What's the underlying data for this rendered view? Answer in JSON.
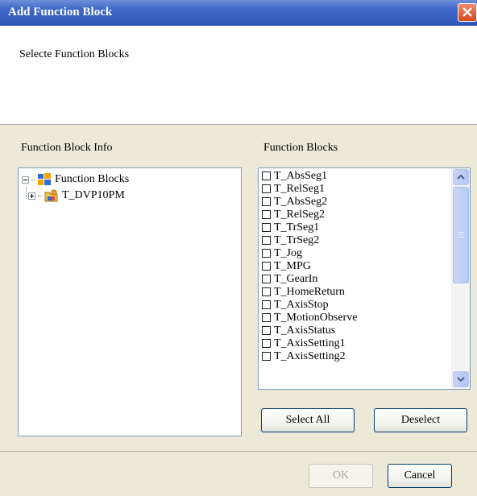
{
  "window": {
    "title": "Add Function Block"
  },
  "header": {
    "text": "Selecte Function Blocks"
  },
  "info_panel": {
    "label": "Function Block Info",
    "tree": [
      {
        "label": "Function Blocks"
      },
      {
        "label": "T_DVP10PM"
      }
    ]
  },
  "blocks_panel": {
    "label": "Function Blocks",
    "items": [
      "T_AbsSeg1",
      "T_RelSeg1",
      "T_AbsSeg2",
      "T_RelSeg2",
      "T_TrSeg1",
      "T_TrSeg2",
      "T_Jog",
      "T_MPG",
      "T_GearIn",
      "T_HomeReturn",
      "T_AxisStop",
      "T_MotionObserve",
      "T_AxisStatus",
      "T_AxisSetting1",
      "T_AxisSetting2"
    ],
    "select_all_label": "Select All",
    "deselect_label": "Deselect"
  },
  "footer": {
    "ok_label": "OK",
    "cancel_label": "Cancel"
  }
}
